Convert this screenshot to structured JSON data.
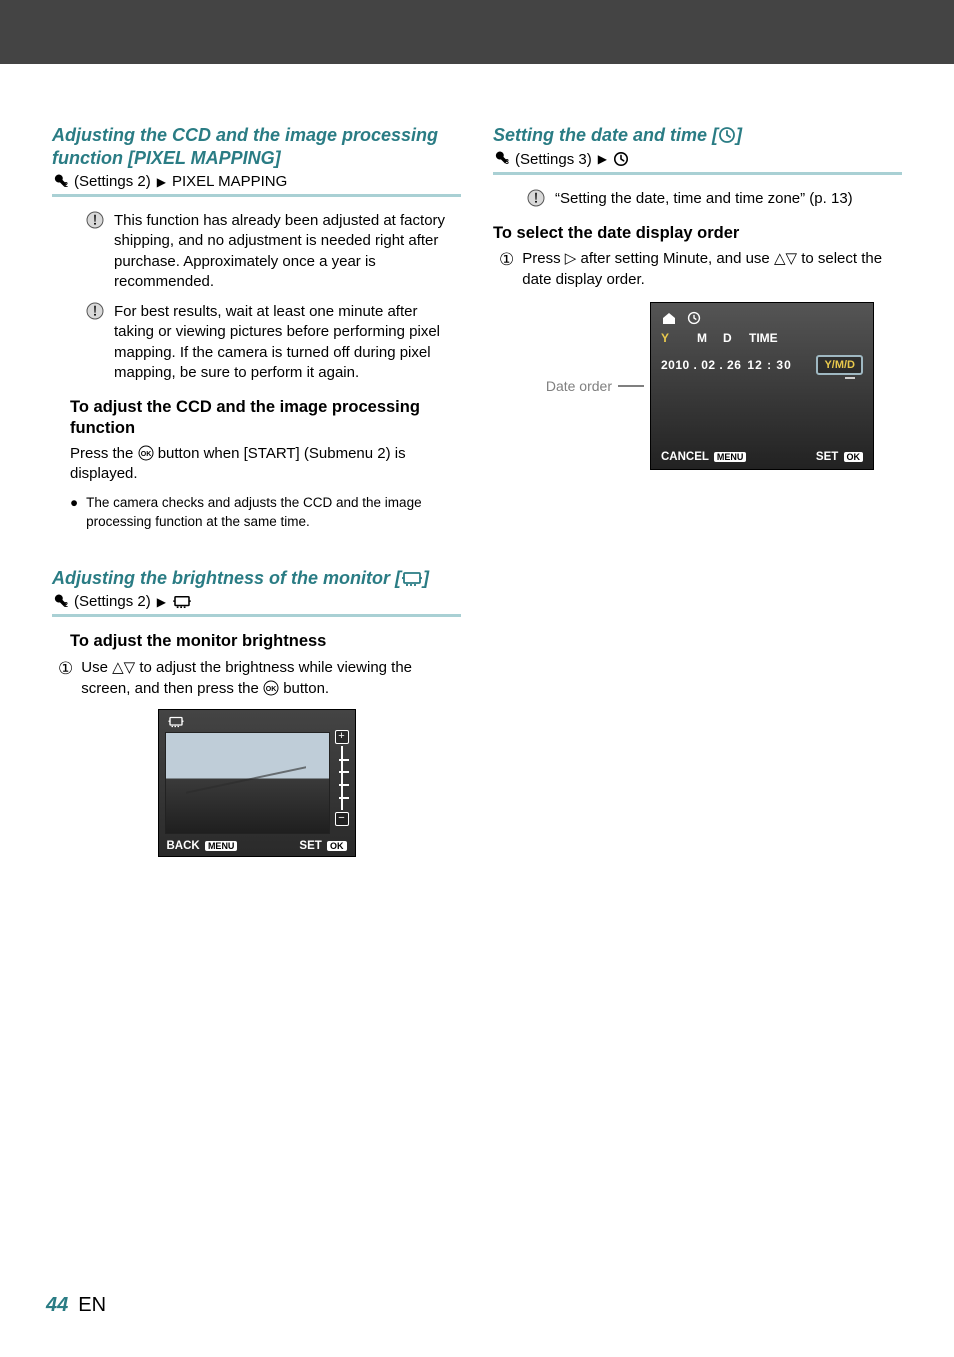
{
  "page": {
    "number": "44",
    "lang": "EN"
  },
  "pixel_mapping": {
    "title": "Adjusting the CCD and the image processing function [PIXEL MAPPING]",
    "path_menu": "(Settings 2)",
    "path_item": "PIXEL MAPPING",
    "note1": "This function has already been adjusted at factory shipping, and no adjustment is needed right after purchase. Approximately once a year is recommended.",
    "note2": "For best results, wait at least one minute after taking or viewing pictures before performing pixel mapping. If the camera is turned off during pixel mapping, be sure to perform it again.",
    "subhead": "To adjust the CCD and the image processing function",
    "para_prefix": "Press the ",
    "para_suffix": " button when [START] (Submenu 2) is displayed.",
    "bullet": "The camera checks and adjusts the CCD and the image processing function at the same time."
  },
  "brightness": {
    "title_prefix": "Adjusting the brightness of the monitor [",
    "title_suffix": "]",
    "path_menu": "(Settings 2)",
    "subhead": "To adjust the monitor brightness",
    "step_prefix": "Use ",
    "step_mid": " to adjust the brightness while viewing the screen, and then press the ",
    "step_suffix": " button.",
    "screen": {
      "back": "BACK",
      "back_key": "MENU",
      "set": "SET",
      "set_key": "OK",
      "plus": "+",
      "minus": "−"
    }
  },
  "datetime": {
    "title_prefix": "Setting the date and time [",
    "title_suffix": "]",
    "path_menu": "(Settings 3)",
    "note": "“Setting the date, time and time zone” (p. 13)",
    "subhead": "To select the date display order",
    "step_prefix": "Press ",
    "step_mid": " after setting Minute, and use ",
    "step_suffix": " to select the date display order.",
    "label": "Date order",
    "screen": {
      "hdr_y": "Y",
      "hdr_m": "M",
      "hdr_d": "D",
      "hdr_time": "TIME",
      "date": "2010 . 02 . 26",
      "time": "12 : 30",
      "order": "Y/M/D",
      "cancel": "CANCEL",
      "cancel_key": "MENU",
      "set": "SET",
      "set_key": "OK"
    }
  }
}
